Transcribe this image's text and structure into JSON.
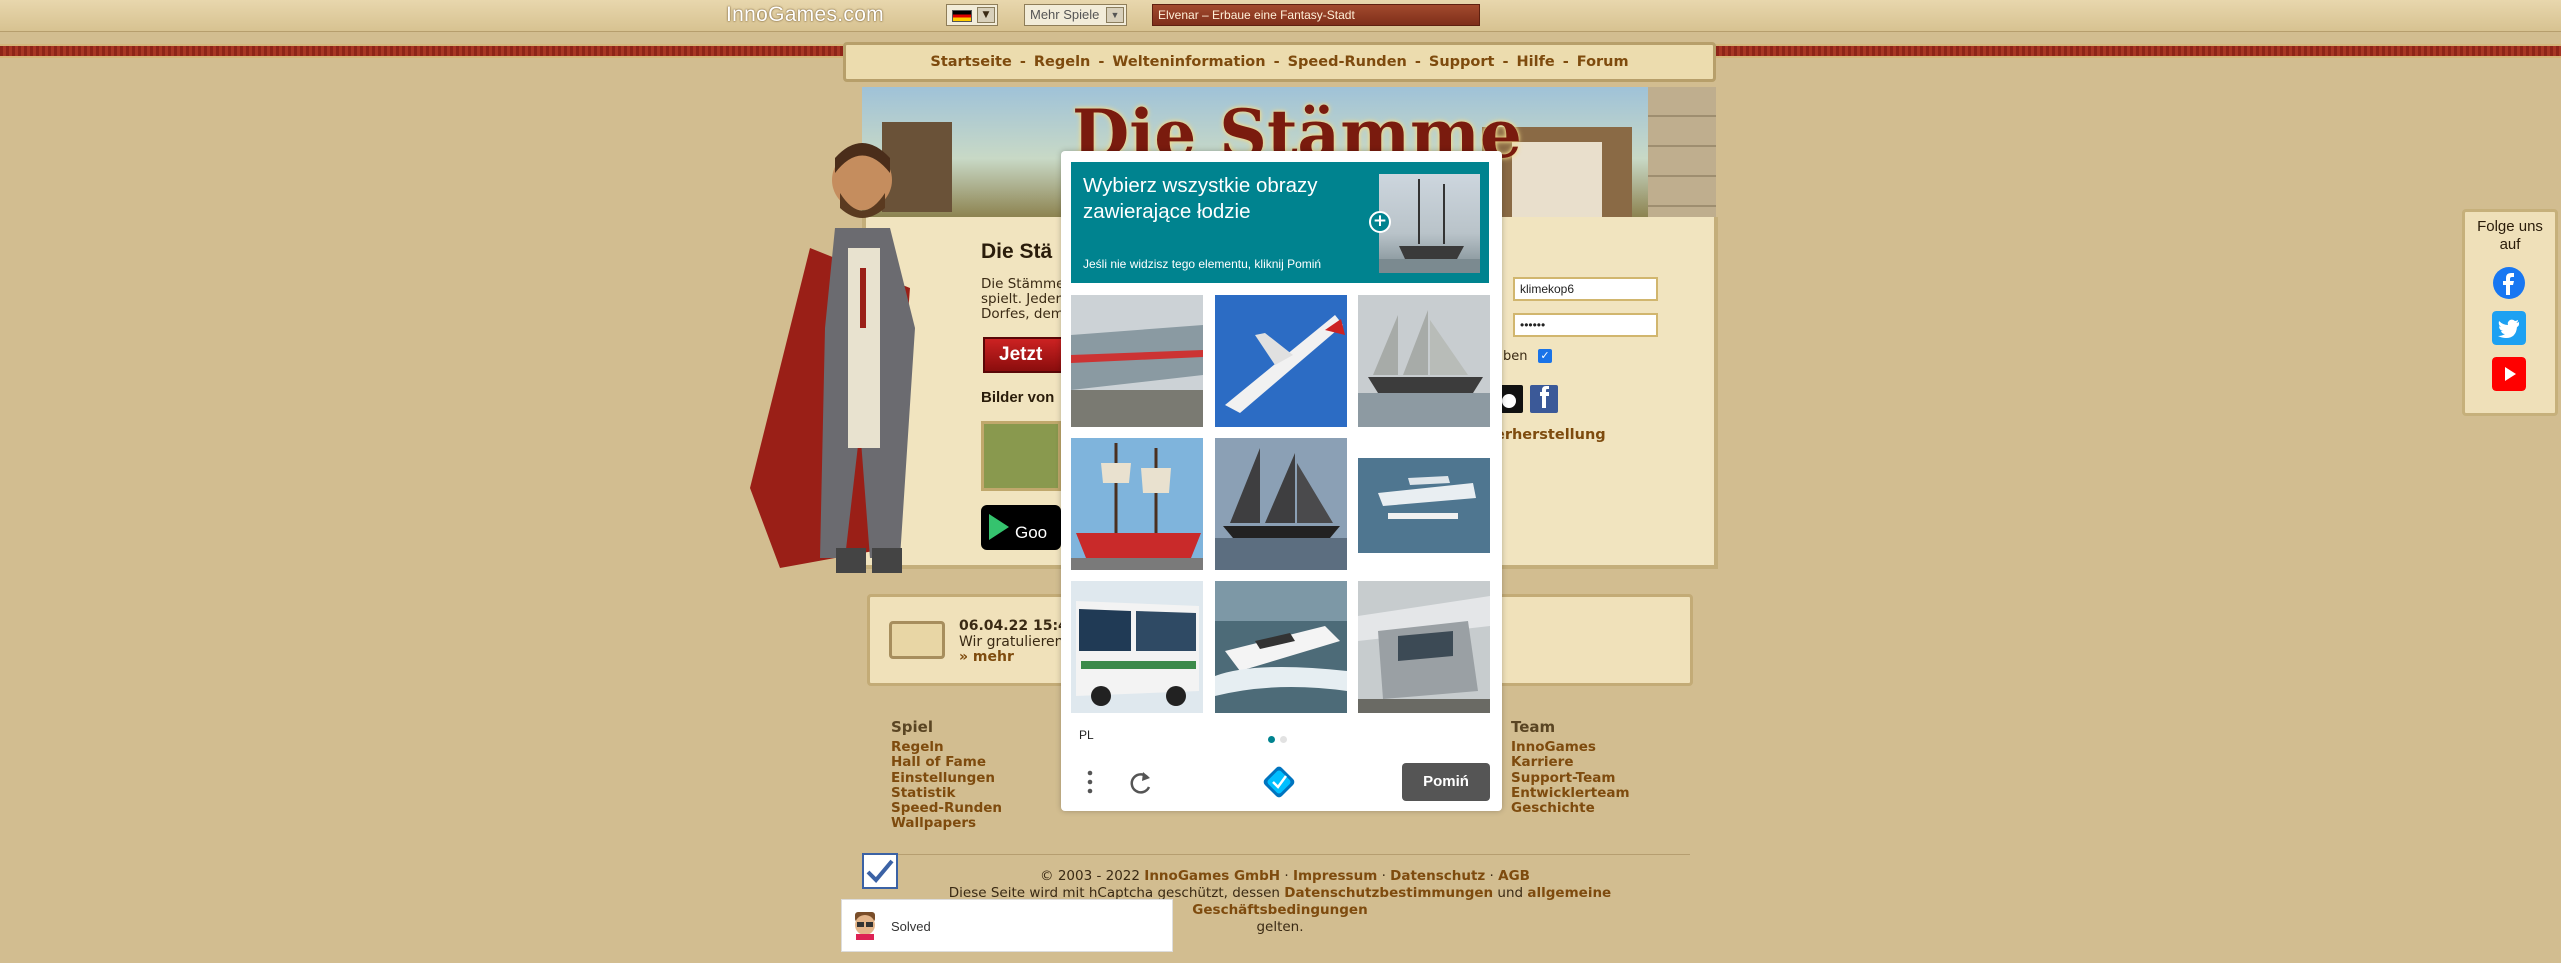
{
  "topbar": {
    "logo": "InnoGames.com",
    "games_select": "Mehr Spiele",
    "banner": "Elvenar – Erbaue eine Fantasy-Stadt"
  },
  "nav": {
    "items": [
      "Startseite",
      "Regeln",
      "Welteninformation",
      "Speed-Runden",
      "Support",
      "Hilfe",
      "Forum"
    ],
    "separator": "-"
  },
  "header": {
    "title": "Die Stämme"
  },
  "landing": {
    "title": "Die Stä",
    "text_lines": [
      "Die Stämme",
      "spielt. Jeder",
      "Dorfes, dem"
    ],
    "play_button": "Jetzt",
    "images_title": "Bilder von"
  },
  "login": {
    "username_value": "klimekop6",
    "password_value": "••••••",
    "remember_label": "ben",
    "remember_checked": true,
    "restore_link": "erherstellung"
  },
  "news": {
    "date": "06.04.22 15:4",
    "text": "Wir gratulieren",
    "more": "» mehr"
  },
  "footer": {
    "col1": {
      "title": "Spiel",
      "links": [
        "Regeln",
        "Hall of Fame",
        "Einstellungen",
        "Statistik",
        "Speed-Runden",
        "Wallpapers"
      ]
    },
    "col2": {
      "title": "Team",
      "links": [
        "InnoGames",
        "Karriere",
        "Support-Team",
        "Entwicklerteam",
        "Geschichte"
      ]
    },
    "copyright_prefix": "© 2003 - 2022",
    "copyright_links": [
      "InnoGames GmbH",
      "Impressum",
      "Datenschutz",
      "AGB"
    ],
    "hcaptcha_prefix": "Diese Seite wird mit hCaptcha geschützt, dessen",
    "hcaptcha_privacy": "Datenschutzbestimmungen",
    "hcaptcha_and": "und",
    "hcaptcha_terms": "allgemeine Geschäftsbedingungen",
    "hcaptcha_suffix": "gelten."
  },
  "follow": {
    "title": "Folge uns auf"
  },
  "solved": {
    "text": "Solved"
  },
  "captcha": {
    "prompt": "Wybierz wszystkie obrazy zawierające łodzie",
    "subtitle": "Jeśli nie widzisz tego elementu, kliknij Pomiń",
    "language": "PL",
    "skip_button": "Pomiń",
    "tiles": [
      "train",
      "airplane",
      "sailboat",
      "sailboat",
      "sailboat",
      "seaplane",
      "bus",
      "motorboat",
      "train"
    ],
    "accent_color": "#00838f"
  }
}
